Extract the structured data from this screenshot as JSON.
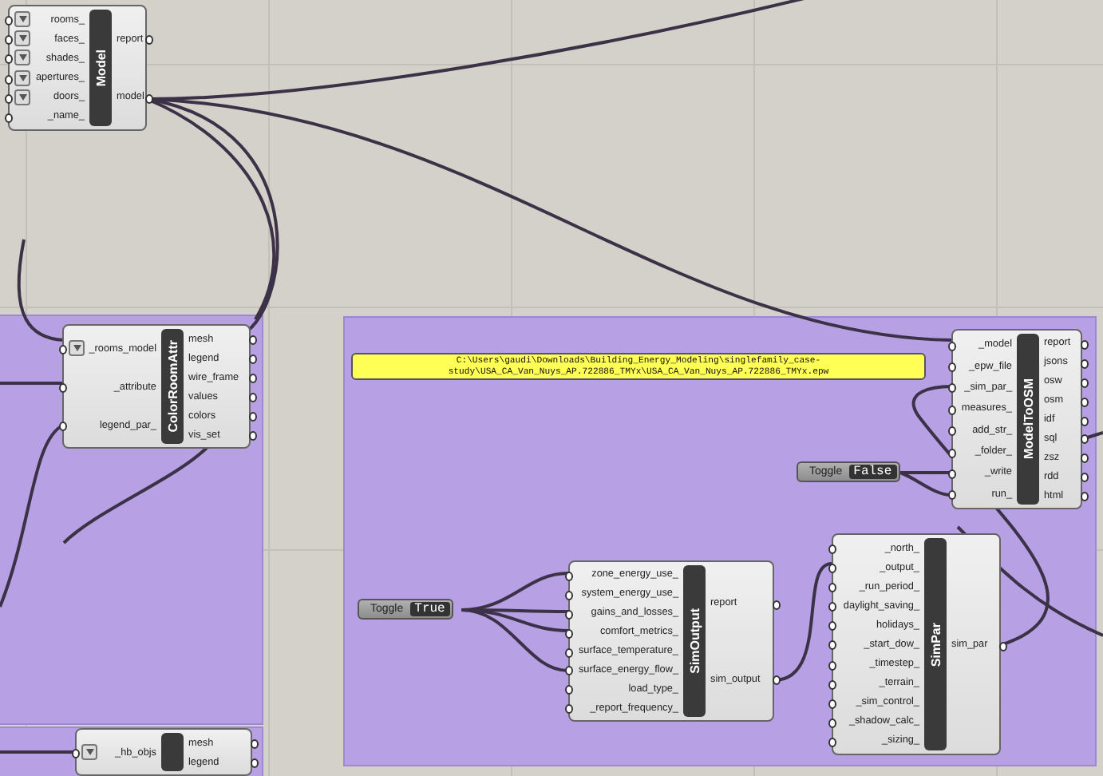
{
  "components": [
    {
      "title": "Model",
      "inputs": [
        {
          "label": "rooms_",
          "menu": true
        },
        {
          "label": "faces_",
          "menu": true
        },
        {
          "label": "shades_",
          "menu": true
        },
        {
          "label": "apertures_",
          "menu": true
        },
        {
          "label": "doors_",
          "menu": true
        },
        {
          "label": "_name_",
          "menu": false
        }
      ],
      "outputs": [
        "report",
        "model"
      ]
    },
    {
      "title": "ColorRoomAttr",
      "inputs": [
        {
          "label": "_rooms_model",
          "menu": true
        },
        {
          "label": "_attribute",
          "menu": false
        },
        {
          "label": "legend_par_",
          "menu": false
        }
      ],
      "outputs": [
        "mesh",
        "legend",
        "wire_frame",
        "values",
        "colors",
        "vis_set"
      ]
    },
    {
      "title": "ModelToOSM",
      "inputs": [
        {
          "label": "_model",
          "menu": false
        },
        {
          "label": "_epw_file",
          "menu": false
        },
        {
          "label": "_sim_par_",
          "menu": false
        },
        {
          "label": "measures_",
          "menu": false
        },
        {
          "label": "add_str_",
          "menu": false
        },
        {
          "label": "_folder_",
          "menu": false
        },
        {
          "label": "_write",
          "menu": false
        },
        {
          "label": "run_",
          "menu": false
        }
      ],
      "outputs": [
        "report",
        "jsons",
        "osw",
        "osm",
        "idf",
        "sql",
        "zsz",
        "rdd",
        "html"
      ]
    },
    {
      "title": "SimOutput",
      "inputs": [
        {
          "label": "zone_energy_use_",
          "menu": false
        },
        {
          "label": "system_energy_use_",
          "menu": false
        },
        {
          "label": "gains_and_losses_",
          "menu": false
        },
        {
          "label": "comfort_metrics_",
          "menu": false
        },
        {
          "label": "surface_temperature_",
          "menu": false
        },
        {
          "label": "surface_energy_flow_",
          "menu": false
        },
        {
          "label": "load_type_",
          "menu": false
        },
        {
          "label": "_report_frequency_",
          "menu": false
        }
      ],
      "outputs": [
        "report",
        "sim_output"
      ]
    },
    {
      "title": "SimPar",
      "inputs": [
        {
          "label": "_north_",
          "menu": false
        },
        {
          "label": "_output_",
          "menu": false
        },
        {
          "label": "_run_period_",
          "menu": false
        },
        {
          "label": "daylight_saving_",
          "menu": false
        },
        {
          "label": "holidays_",
          "menu": false
        },
        {
          "label": "_start_dow_",
          "menu": false
        },
        {
          "label": "_timestep_",
          "menu": false
        },
        {
          "label": "_terrain_",
          "menu": false
        },
        {
          "label": "_sim_control_",
          "menu": false
        },
        {
          "label": "_shadow_calc_",
          "menu": false
        },
        {
          "label": "_sizing_",
          "menu": false
        }
      ],
      "outputs": [
        "sim_par"
      ]
    },
    {
      "inputs": [
        {
          "label": "_hb_objs",
          "menu": true
        }
      ],
      "outputs": [
        "mesh",
        "legend"
      ]
    }
  ],
  "panels": [
    {
      "lines": [
        "C:\\Users\\gaudi\\Downloads\\Building_Energy_Modeling\\singlefamily_case-",
        "study\\USA_CA_Van_Nuys_AP.722886_TMYx\\USA_CA_Van_Nuys_AP.722886_TMYx.epw"
      ]
    }
  ],
  "toggles": [
    {
      "label": "Toggle",
      "value": "False"
    },
    {
      "label": "Toggle",
      "value": "True"
    }
  ]
}
